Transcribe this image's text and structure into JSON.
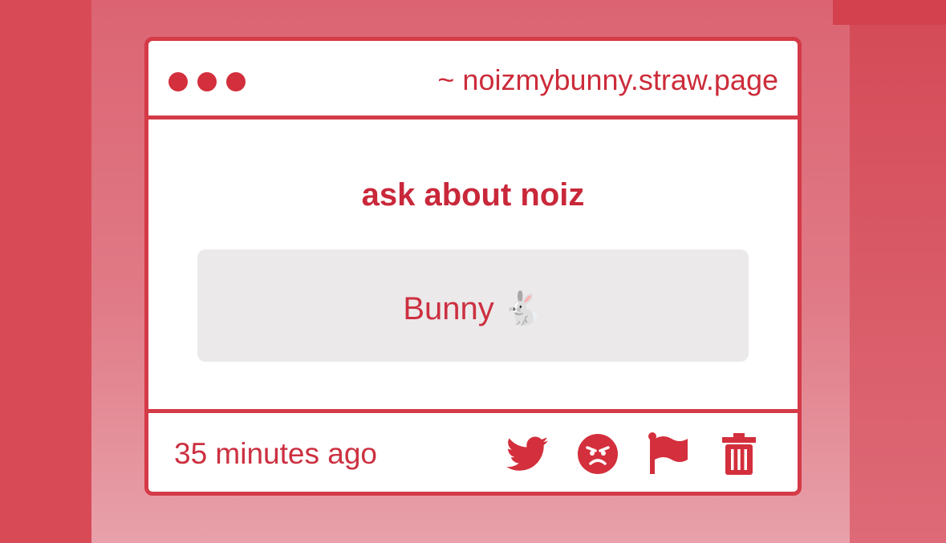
{
  "window": {
    "url": "~ noizmybunny.straw.page"
  },
  "question": {
    "title": "ask about noiz"
  },
  "answer": {
    "text": "Bunny 🐇"
  },
  "footer": {
    "timestamp": "35 minutes ago",
    "actions": [
      {
        "name": "twitter-share",
        "icon": "twitter-bird-icon"
      },
      {
        "name": "angry-reaction",
        "icon": "angry-face-icon"
      },
      {
        "name": "report",
        "icon": "flag-icon"
      },
      {
        "name": "delete",
        "icon": "trash-icon"
      }
    ]
  },
  "colors": {
    "accent": "#d43a47",
    "text_red": "#cc3040",
    "answer_bg": "#ebe9ea",
    "background": "#d94a57"
  }
}
